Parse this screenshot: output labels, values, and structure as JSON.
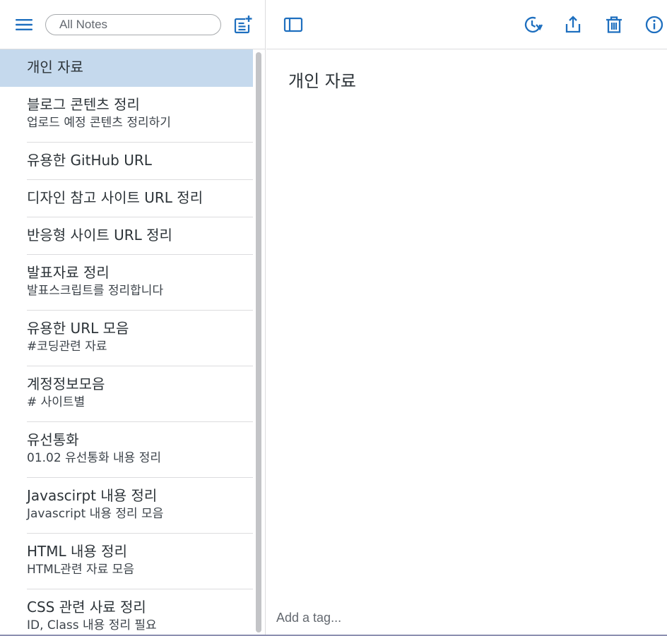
{
  "colors": {
    "accent": "#1e6fbf",
    "selected_bg": "#c5d9ed",
    "border": "#dcdcde"
  },
  "sidebar": {
    "menu_icon": "hamburger-menu-icon",
    "search": {
      "placeholder": "All Notes",
      "value": ""
    },
    "new_note_icon": "new-note-icon"
  },
  "notes": [
    {
      "title": "개인 자료",
      "preview": "",
      "selected": true
    },
    {
      "title": "블로그 콘텐츠 정리",
      "preview": "업로드 예정 콘텐츠 정리하기"
    },
    {
      "title": "유용한 GitHub URL",
      "preview": ""
    },
    {
      "title": "디자인 참고 사이트 URL 정리",
      "preview": ""
    },
    {
      "title": "반응형 사이트 URL 정리",
      "preview": ""
    },
    {
      "title": "발표자료 정리",
      "preview": "발표스크립트를 정리합니다"
    },
    {
      "title": "유용한 URL 모음",
      "preview": "#코딩관련 자료"
    },
    {
      "title": "계정정보모음",
      "preview": "# 사이트별"
    },
    {
      "title": "유선통화",
      "preview": "01.02 유선통화 내용 정리"
    },
    {
      "title": "Javascirpt 내용 정리",
      "preview": "Javascript 내용 정리 모음"
    },
    {
      "title": "HTML 내용 정리",
      "preview": "HTML관련 자료 모음"
    },
    {
      "title": "CSS 관련 사료 정리",
      "preview": "ID, Class 내용 정리 필요"
    }
  ],
  "editor": {
    "toolbar_icons": [
      "sidebar-toggle-icon",
      "history-icon",
      "share-icon",
      "trash-icon",
      "info-icon"
    ],
    "content_title": "개인 자료",
    "tag_placeholder": "Add a tag..."
  }
}
